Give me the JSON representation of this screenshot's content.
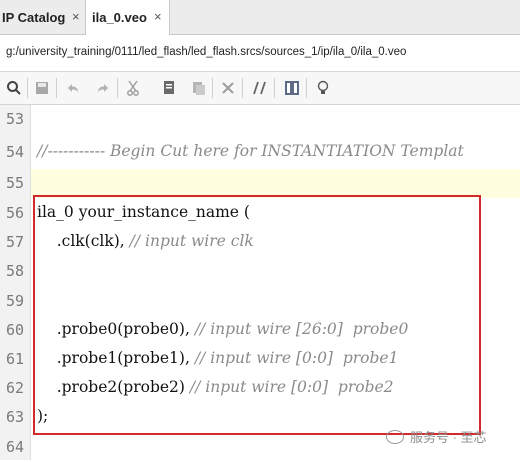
{
  "tabs": [
    {
      "label": "IP Catalog",
      "close": "×"
    },
    {
      "label": "ila_0.veo",
      "close": "×"
    }
  ],
  "path": "g:/university_training/0111/led_flash/led_flash.srcs/sources_1/ip/ila_0/ila_0.veo",
  "toolbar_icons": [
    "search-icon",
    "save-icon",
    "undo-icon",
    "redo-icon",
    "cut-icon",
    "copy-icon",
    "paste-icon",
    "delete-icon",
    "comment-icon",
    "column-icon",
    "lightbulb-icon"
  ],
  "lines": [
    {
      "num": "53",
      "code": "",
      "comment": ""
    },
    {
      "num": "54",
      "code": "",
      "comment": "//----------- Begin Cut here for INSTANTIATION Templat"
    },
    {
      "num": "55",
      "code": "",
      "comment": ""
    },
    {
      "num": "56",
      "code": "ila_0 your_instance_name (",
      "comment": ""
    },
    {
      "num": "57",
      "code": "    .clk(clk), ",
      "comment": "// input wire clk"
    },
    {
      "num": "58",
      "code": "",
      "comment": ""
    },
    {
      "num": "59",
      "code": "",
      "comment": ""
    },
    {
      "num": "60",
      "code": "    .probe0(probe0), ",
      "comment": "// input wire [26:0]  probe0"
    },
    {
      "num": "61",
      "code": "    .probe1(probe1), ",
      "comment": "// input wire [0:0]  probe1"
    },
    {
      "num": "62",
      "code": "    .probe2(probe2) ",
      "comment": "// input wire [0:0]  probe2"
    },
    {
      "num": "63",
      "code": ");",
      "comment": ""
    },
    {
      "num": "64",
      "code": "",
      "comment": ""
    }
  ],
  "watermark": "服务号 · 至芯"
}
